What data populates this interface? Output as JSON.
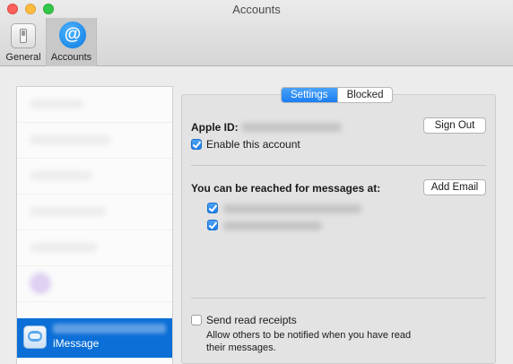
{
  "window": {
    "title": "Accounts"
  },
  "toolbar": {
    "items": [
      {
        "label": "General",
        "icon": "switch-icon"
      },
      {
        "label": "Accounts",
        "icon": "at-sign-icon",
        "selected": true
      }
    ]
  },
  "sidebar": {
    "accounts": [
      {
        "label": "iMessage",
        "selected": true
      }
    ]
  },
  "tabs": [
    {
      "label": "Settings",
      "active": true
    },
    {
      "label": "Blocked",
      "active": false
    }
  ],
  "settings": {
    "apple_id_label": "Apple ID:",
    "sign_out_button": "Sign Out",
    "enable_account_label": "Enable this account",
    "enable_account_checked": true,
    "reach_label": "You can be reached for messages at:",
    "add_email_button": "Add Email",
    "reach_addresses": [
      {
        "checked": true
      },
      {
        "checked": true
      }
    ],
    "read_receipts_label": "Send read receipts",
    "read_receipts_checked": false,
    "read_receipts_hint": "Allow others to be notified when you have read their messages."
  },
  "colors": {
    "selection": "#0b6fd7",
    "accent": "#1a7ef2"
  }
}
